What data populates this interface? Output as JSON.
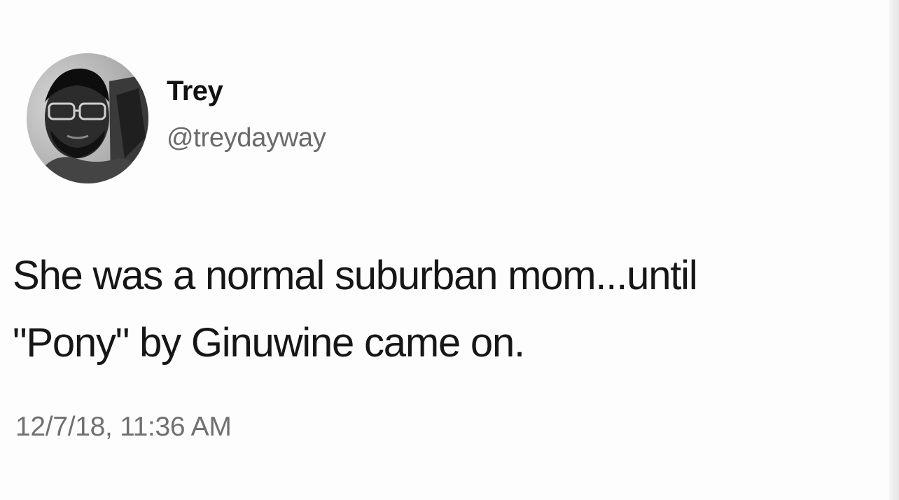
{
  "tweet": {
    "display_name": "Trey",
    "handle": "@treydayway",
    "text_lines": [
      "She was a normal suburban mom...until",
      "\"Pony\" by Ginuwine came on."
    ],
    "timestamp": "12/7/18, 11:36 AM"
  },
  "avatar": {
    "icon": "profile-photo-icon"
  },
  "colors": {
    "background": "#fdfdfd",
    "name": "#111111",
    "handle": "#6a6a6a",
    "body": "#161616",
    "timestamp": "#707070"
  }
}
